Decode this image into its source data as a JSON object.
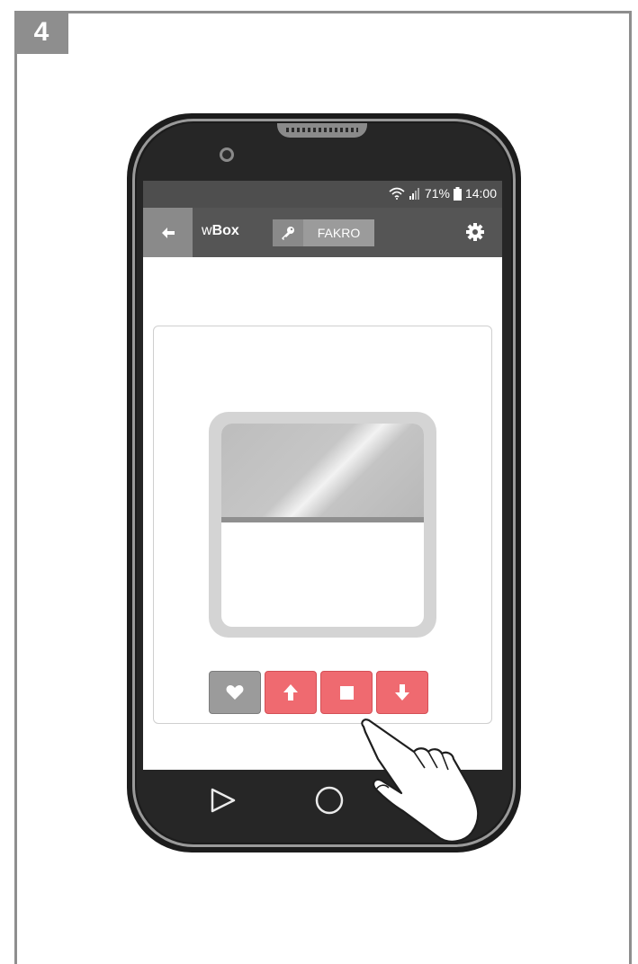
{
  "step": {
    "number": "4"
  },
  "status_bar": {
    "battery_percent": "71%",
    "time": "14:00"
  },
  "app_bar": {
    "title_prefix": "w",
    "title_bold": "Box",
    "key_label": "FAKRO"
  },
  "blind": {
    "position_fraction_open": 0.46
  },
  "controls": [
    {
      "name": "favorite",
      "icon": "heart-icon"
    },
    {
      "name": "up",
      "icon": "arrow-up-icon"
    },
    {
      "name": "stop",
      "icon": "stop-icon"
    },
    {
      "name": "down",
      "icon": "arrow-down-icon"
    }
  ],
  "colors": {
    "accent_red": "#ef6a70",
    "app_bar": "#555555",
    "frame_gray": "#8e8e8e"
  }
}
